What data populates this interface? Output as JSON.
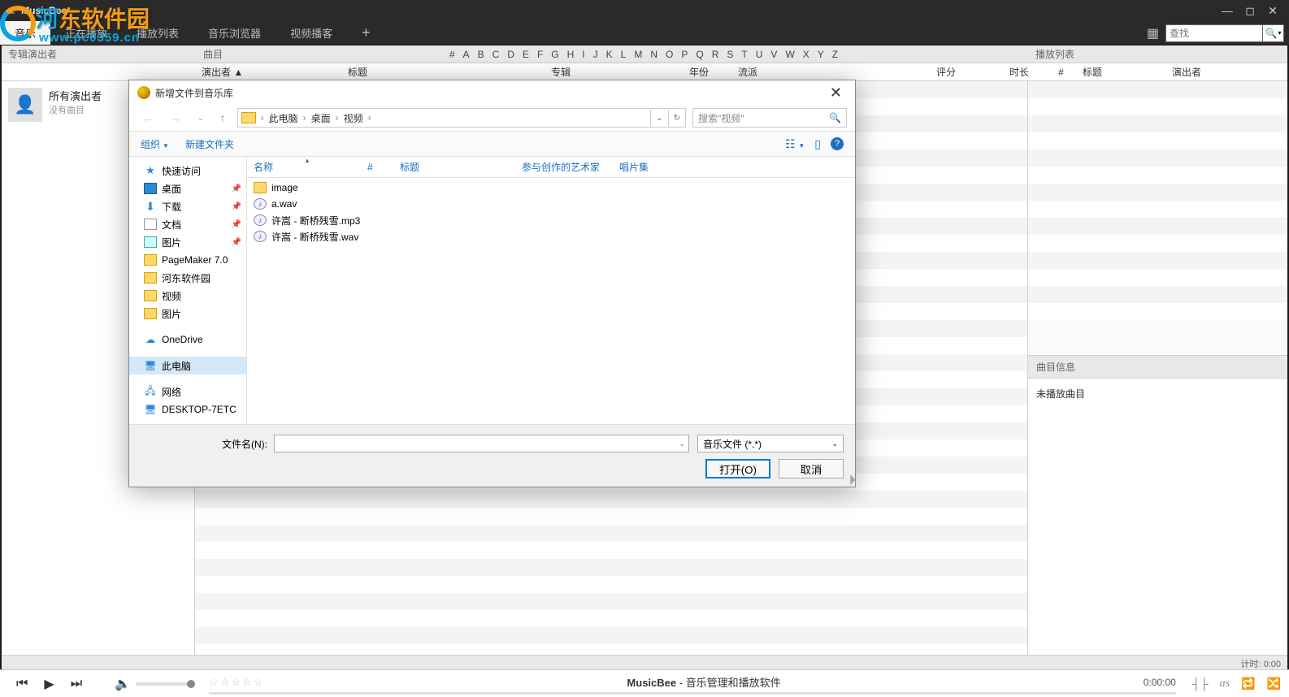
{
  "app": {
    "title": "MusicBee"
  },
  "tabs": [
    "音乐",
    "正在播放",
    "播放列表",
    "音乐浏览器",
    "视频播客"
  ],
  "search_placeholder": "查找",
  "headers": {
    "left": "专辑演出者",
    "mid_label": "曲目",
    "right": "播放列表"
  },
  "alpha": [
    "#",
    "A",
    "B",
    "C",
    "D",
    "E",
    "F",
    "G",
    "H",
    "I",
    "J",
    "K",
    "L",
    "M",
    "N",
    "O",
    "P",
    "Q",
    "R",
    "S",
    "T",
    "U",
    "V",
    "W",
    "X",
    "Y",
    "Z"
  ],
  "columns_main": [
    "演出者 ▲",
    "标题",
    "专辑",
    "年份",
    "流派",
    "评分",
    "时长"
  ],
  "columns_queue": [
    "#",
    "标题",
    "演出者"
  ],
  "artist": {
    "name": "所有演出者",
    "sub": "没有曲目"
  },
  "right": {
    "info_head": "曲目信息",
    "info_body": "未播放曲目"
  },
  "status": "计时: 0:00",
  "player": {
    "title_prefix": "MusicBee",
    "title_suffix": " - 音乐管理和播放软件",
    "time": "0:00:00"
  },
  "dialog": {
    "title": "新增文件到音乐库",
    "crumbs": [
      "此电脑",
      "桌面",
      "视频"
    ],
    "search_hint": "搜索\"视频\"",
    "organize": "组织",
    "new_folder": "新建文件夹",
    "tree": [
      {
        "label": "快速访问",
        "icon": "star"
      },
      {
        "label": "桌面",
        "icon": "desk",
        "pin": true
      },
      {
        "label": "下载",
        "icon": "dl",
        "pin": true
      },
      {
        "label": "文档",
        "icon": "doc",
        "pin": true
      },
      {
        "label": "图片",
        "icon": "pic",
        "pin": true
      },
      {
        "label": "PageMaker 7.0",
        "icon": "fold"
      },
      {
        "label": "河东软件园",
        "icon": "fold"
      },
      {
        "label": "视频",
        "icon": "fold"
      },
      {
        "label": "图片",
        "icon": "fold"
      },
      {
        "gap": true
      },
      {
        "label": "OneDrive",
        "icon": "cld"
      },
      {
        "gap": true
      },
      {
        "label": "此电脑",
        "icon": "pc",
        "selected": true
      },
      {
        "gap": true
      },
      {
        "label": "网络",
        "icon": "net"
      },
      {
        "label": "DESKTOP-7ETC",
        "icon": "pc"
      }
    ],
    "file_headers": {
      "name": "名称",
      "num": "#",
      "title": "标题",
      "artist": "参与创作的艺术家",
      "album": "唱片集"
    },
    "files": [
      {
        "name": "image",
        "type": "folder"
      },
      {
        "name": "a.wav",
        "type": "audio"
      },
      {
        "name": "许嵩 - 断桥残雪.mp3",
        "type": "audio"
      },
      {
        "name": "许嵩 - 断桥残雪.wav",
        "type": "audio"
      }
    ],
    "filename_label": "文件名(N):",
    "filetype": "音乐文件 (*.*)",
    "open": "打开(O)",
    "cancel": "取消"
  },
  "watermark": {
    "text": "河东软件园",
    "url": "www.pc0359.cn"
  }
}
